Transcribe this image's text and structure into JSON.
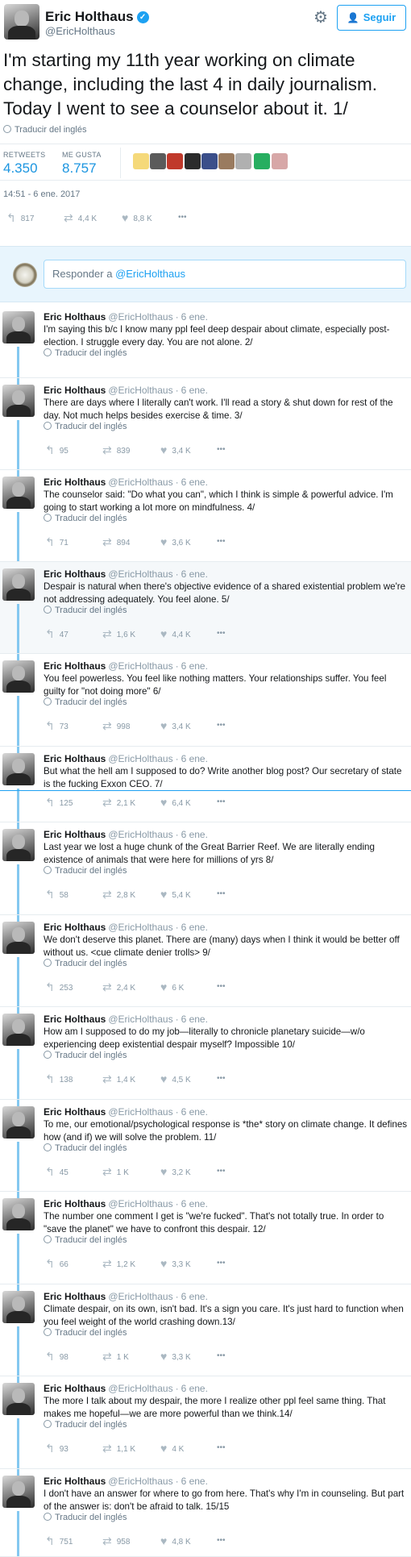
{
  "main_tweet": {
    "author_name": "Eric Holthaus",
    "author_handle": "@EricHolthaus",
    "follow_label": "Seguir",
    "text": "I'm starting my 11th year working on climate change, including the last 4 in daily journalism. Today I went to see a counselor about it. 1/",
    "translate_label": "Traducir del inglés",
    "retweets_label": "RETWEETS",
    "retweets_value": "4.350",
    "likes_label": "ME GUSTA",
    "likes_value": "8.757",
    "timestamp": "14:51 - 6 ene. 2017",
    "actions": {
      "replies": "817",
      "retweets": "4,4 K",
      "likes": "8,8 K"
    },
    "liker_colors": [
      "#f5d97a",
      "#5b5b5b",
      "#c0392b",
      "#2c2c2c",
      "#3b4f8a",
      "#9a7b5f",
      "#b0b0b0",
      "#27ae60",
      "#d7a7a7"
    ]
  },
  "icons": {
    "verified": "✓",
    "gear": "⚙",
    "follow": "👤",
    "reply": "↰",
    "retweet": "⇄",
    "like": "♥",
    "more": "•••"
  },
  "reply_box": {
    "prefix": "Responder a ",
    "mention": "@EricHolthaus"
  },
  "thread": [
    {
      "name": "Eric Holthaus",
      "handle": "@EricHolthaus",
      "date": "6 ene.",
      "text": "I'm saying this b/c I know many ppl feel deep despair about climate, especially post-election. I struggle every day. You are not alone. 2/",
      "translate": "Traducir del inglés",
      "replies": "",
      "retweets": "",
      "likes": ""
    },
    {
      "name": "Eric Holthaus",
      "handle": "@EricHolthaus",
      "date": "6 ene.",
      "text": "There are days where I literally can't work. I'll read a story & shut down for rest of the day. Not much helps besides exercise & time. 3/",
      "translate": "Traducir del inglés",
      "replies": "95",
      "retweets": "839",
      "likes": "3,4 K"
    },
    {
      "name": "Eric Holthaus",
      "handle": "@EricHolthaus",
      "date": "6 ene.",
      "text": "The counselor said: \"Do what you can\", which I think is simple & powerful advice. I'm going to start working a lot more on mindfulness. 4/",
      "translate": "Traducir del inglés",
      "replies": "71",
      "retweets": "894",
      "likes": "3,6 K"
    },
    {
      "name": "Eric Holthaus",
      "handle": "@EricHolthaus",
      "date": "6 ene.",
      "text": "Despair is natural when there's objective evidence of a shared existential problem we're not addressing adequately. You feel alone. 5/",
      "translate": "Traducir del inglés",
      "replies": "47",
      "retweets": "1,6 K",
      "likes": "4,4 K"
    },
    {
      "name": "Eric Holthaus",
      "handle": "@EricHolthaus",
      "date": "6 ene.",
      "text": "You feel powerless. You feel like nothing matters. Your relationships suffer. You feel guilty for \"not doing more\" 6/",
      "translate": "Traducir del inglés",
      "replies": "73",
      "retweets": "998",
      "likes": "3,4 K"
    },
    {
      "name": "Eric Holthaus",
      "handle": "@EricHolthaus",
      "date": "6 ene.",
      "text": "But what the hell am I supposed to do? Write another blog post? Our secretary of state is the fucking Exxon CEO. 7/",
      "translate": "",
      "replies": "125",
      "retweets": "2,1 K",
      "likes": "6,4 K"
    },
    {
      "name": "Eric Holthaus",
      "handle": "@EricHolthaus",
      "date": "6 ene.",
      "text": "Last year we lost a huge chunk of the Great Barrier Reef. We are literally ending existence of animals that were here for millions of yrs 8/",
      "translate": "Traducir del inglés",
      "replies": "58",
      "retweets": "2,8 K",
      "likes": "5,4 K"
    },
    {
      "name": "Eric Holthaus",
      "handle": "@EricHolthaus",
      "date": "6 ene.",
      "text": "We don't deserve this planet. There are (many) days when I think it would be better off without us. <cue climate denier trolls> 9/",
      "translate": "Traducir del inglés",
      "replies": "253",
      "retweets": "2,4 K",
      "likes": "6 K"
    },
    {
      "name": "Eric Holthaus",
      "handle": "@EricHolthaus",
      "date": "6 ene.",
      "text": "How am I supposed to do my job—literally to chronicle planetary suicide—w/o experiencing deep existential despair myself? Impossible 10/",
      "translate": "Traducir del inglés",
      "replies": "138",
      "retweets": "1,4 K",
      "likes": "4,5 K"
    },
    {
      "name": "Eric Holthaus",
      "handle": "@EricHolthaus",
      "date": "6 ene.",
      "text": "To me, our emotional/psychological response is *the* story on climate change. It defines how (and if) we will solve the problem. 11/",
      "translate": "Traducir del inglés",
      "replies": "45",
      "retweets": "1 K",
      "likes": "3,2 K"
    },
    {
      "name": "Eric Holthaus",
      "handle": "@EricHolthaus",
      "date": "6 ene.",
      "text": "The number one comment I get is \"we're fucked\". That's not totally true. In order to \"save the planet\" we have to confront this despair. 12/",
      "translate": "Traducir del inglés",
      "replies": "66",
      "retweets": "1,2 K",
      "likes": "3,3 K"
    },
    {
      "name": "Eric Holthaus",
      "handle": "@EricHolthaus",
      "date": "6 ene.",
      "text": "Climate despair, on its own, isn't bad. It's a sign you care. It's just hard to function when you feel weight of the world crashing down.13/",
      "translate": "Traducir del inglés",
      "replies": "98",
      "retweets": "1 K",
      "likes": "3,3 K"
    },
    {
      "name": "Eric Holthaus",
      "handle": "@EricHolthaus",
      "date": "6 ene.",
      "text": "The more I talk about my despair, the more I realize other ppl feel same thing. That makes me hopeful—we are more powerful than we think.14/",
      "translate": "Traducir del inglés",
      "replies": "93",
      "retweets": "1,1 K",
      "likes": "4 K"
    },
    {
      "name": "Eric Holthaus",
      "handle": "@EricHolthaus",
      "date": "6 ene.",
      "text": "I don't have an answer for where to go from here. That's why I'm in counseling. But part of the answer is: don't be afraid to talk. 15/15",
      "translate": "Traducir del inglés",
      "replies": "751",
      "retweets": "958",
      "likes": "4,8 K"
    }
  ]
}
